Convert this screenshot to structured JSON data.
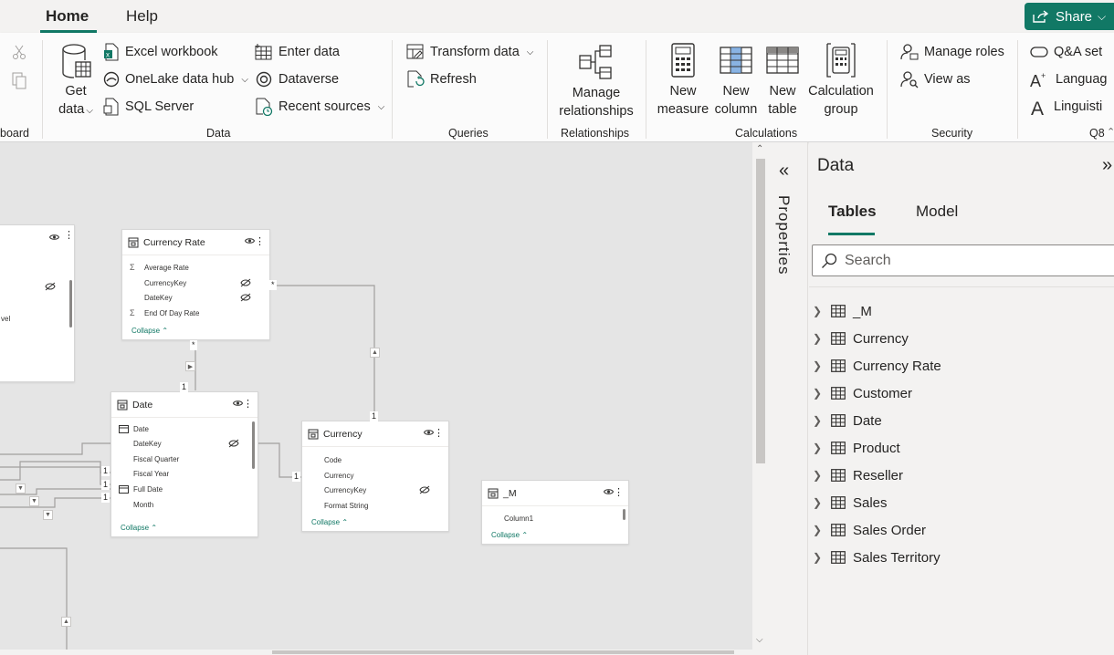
{
  "tabs": [
    {
      "label": "Home",
      "active": true
    },
    {
      "label": "Help",
      "active": false
    }
  ],
  "share": {
    "label": "Share"
  },
  "ribbon": {
    "clipboard": {
      "label": "board"
    },
    "data": {
      "label": "Data",
      "get_data": {
        "line1": "Get",
        "line2": "data"
      },
      "excel": "Excel workbook",
      "onelake": "OneLake data hub",
      "sql": "SQL Server",
      "enter_data": "Enter data",
      "dataverse": "Dataverse",
      "recent": "Recent sources"
    },
    "queries": {
      "label": "Queries",
      "transform": "Transform data",
      "refresh": "Refresh"
    },
    "relationships": {
      "label": "Relationships",
      "manage": {
        "line1": "Manage",
        "line2": "relationships"
      }
    },
    "calculations": {
      "label": "Calculations",
      "new_measure": {
        "line1": "New",
        "line2": "measure"
      },
      "new_column": {
        "line1": "New",
        "line2": "column"
      },
      "new_table": {
        "line1": "New",
        "line2": "table"
      },
      "calc_group": {
        "line1": "Calculation",
        "line2": "group"
      }
    },
    "security": {
      "label": "Security",
      "manage_roles": "Manage roles",
      "view_as": "View as"
    },
    "qa": {
      "label": "Q8",
      "qa_setup": "Q&A set",
      "language": "Languag",
      "linguistic": "Linguisti"
    }
  },
  "canvas": {
    "partial_card": {
      "field_fragment": "vel"
    },
    "cards": {
      "currency_rate": {
        "title": "Currency Rate",
        "fields": [
          {
            "icon": "Σ",
            "name": "Average Rate",
            "hidden": false
          },
          {
            "icon": "",
            "name": "CurrencyKey",
            "hidden": true
          },
          {
            "icon": "",
            "name": "DateKey",
            "hidden": true
          },
          {
            "icon": "Σ",
            "name": "End Of Day Rate",
            "hidden": false
          }
        ],
        "collapse": "Collapse"
      },
      "date": {
        "title": "Date",
        "fields": [
          {
            "icon": "cal",
            "name": "Date",
            "hidden": false
          },
          {
            "icon": "",
            "name": "DateKey",
            "hidden": true
          },
          {
            "icon": "",
            "name": "Fiscal Quarter",
            "hidden": false
          },
          {
            "icon": "",
            "name": "Fiscal Year",
            "hidden": false
          },
          {
            "icon": "cal",
            "name": "Full Date",
            "hidden": false
          },
          {
            "icon": "",
            "name": "Month",
            "hidden": false
          }
        ],
        "collapse": "Collapse"
      },
      "currency": {
        "title": "Currency",
        "fields": [
          {
            "icon": "",
            "name": "Code",
            "hidden": false
          },
          {
            "icon": "",
            "name": "Currency",
            "hidden": false
          },
          {
            "icon": "",
            "name": "CurrencyKey",
            "hidden": true
          },
          {
            "icon": "",
            "name": "Format String",
            "hidden": false
          }
        ],
        "collapse": "Collapse"
      },
      "m": {
        "title": "_M",
        "fields": [
          {
            "icon": "",
            "name": "Column1",
            "hidden": false
          }
        ],
        "collapse": "Collapse"
      }
    },
    "relation_labels": {
      "many": "*",
      "one": "1"
    }
  },
  "properties": {
    "label": "Properties"
  },
  "data_pane": {
    "title": "Data",
    "tabs": [
      {
        "label": "Tables",
        "active": true
      },
      {
        "label": "Model",
        "active": false
      }
    ],
    "search_placeholder": "Search",
    "tables": [
      "_M",
      "Currency",
      "Currency Rate",
      "Customer",
      "Date",
      "Product",
      "Reseller",
      "Sales",
      "Sales Order",
      "Sales Territory"
    ]
  },
  "colors": {
    "accent": "#117865",
    "canvas": "#e5e5e5",
    "pane": "#f3f2f1"
  }
}
